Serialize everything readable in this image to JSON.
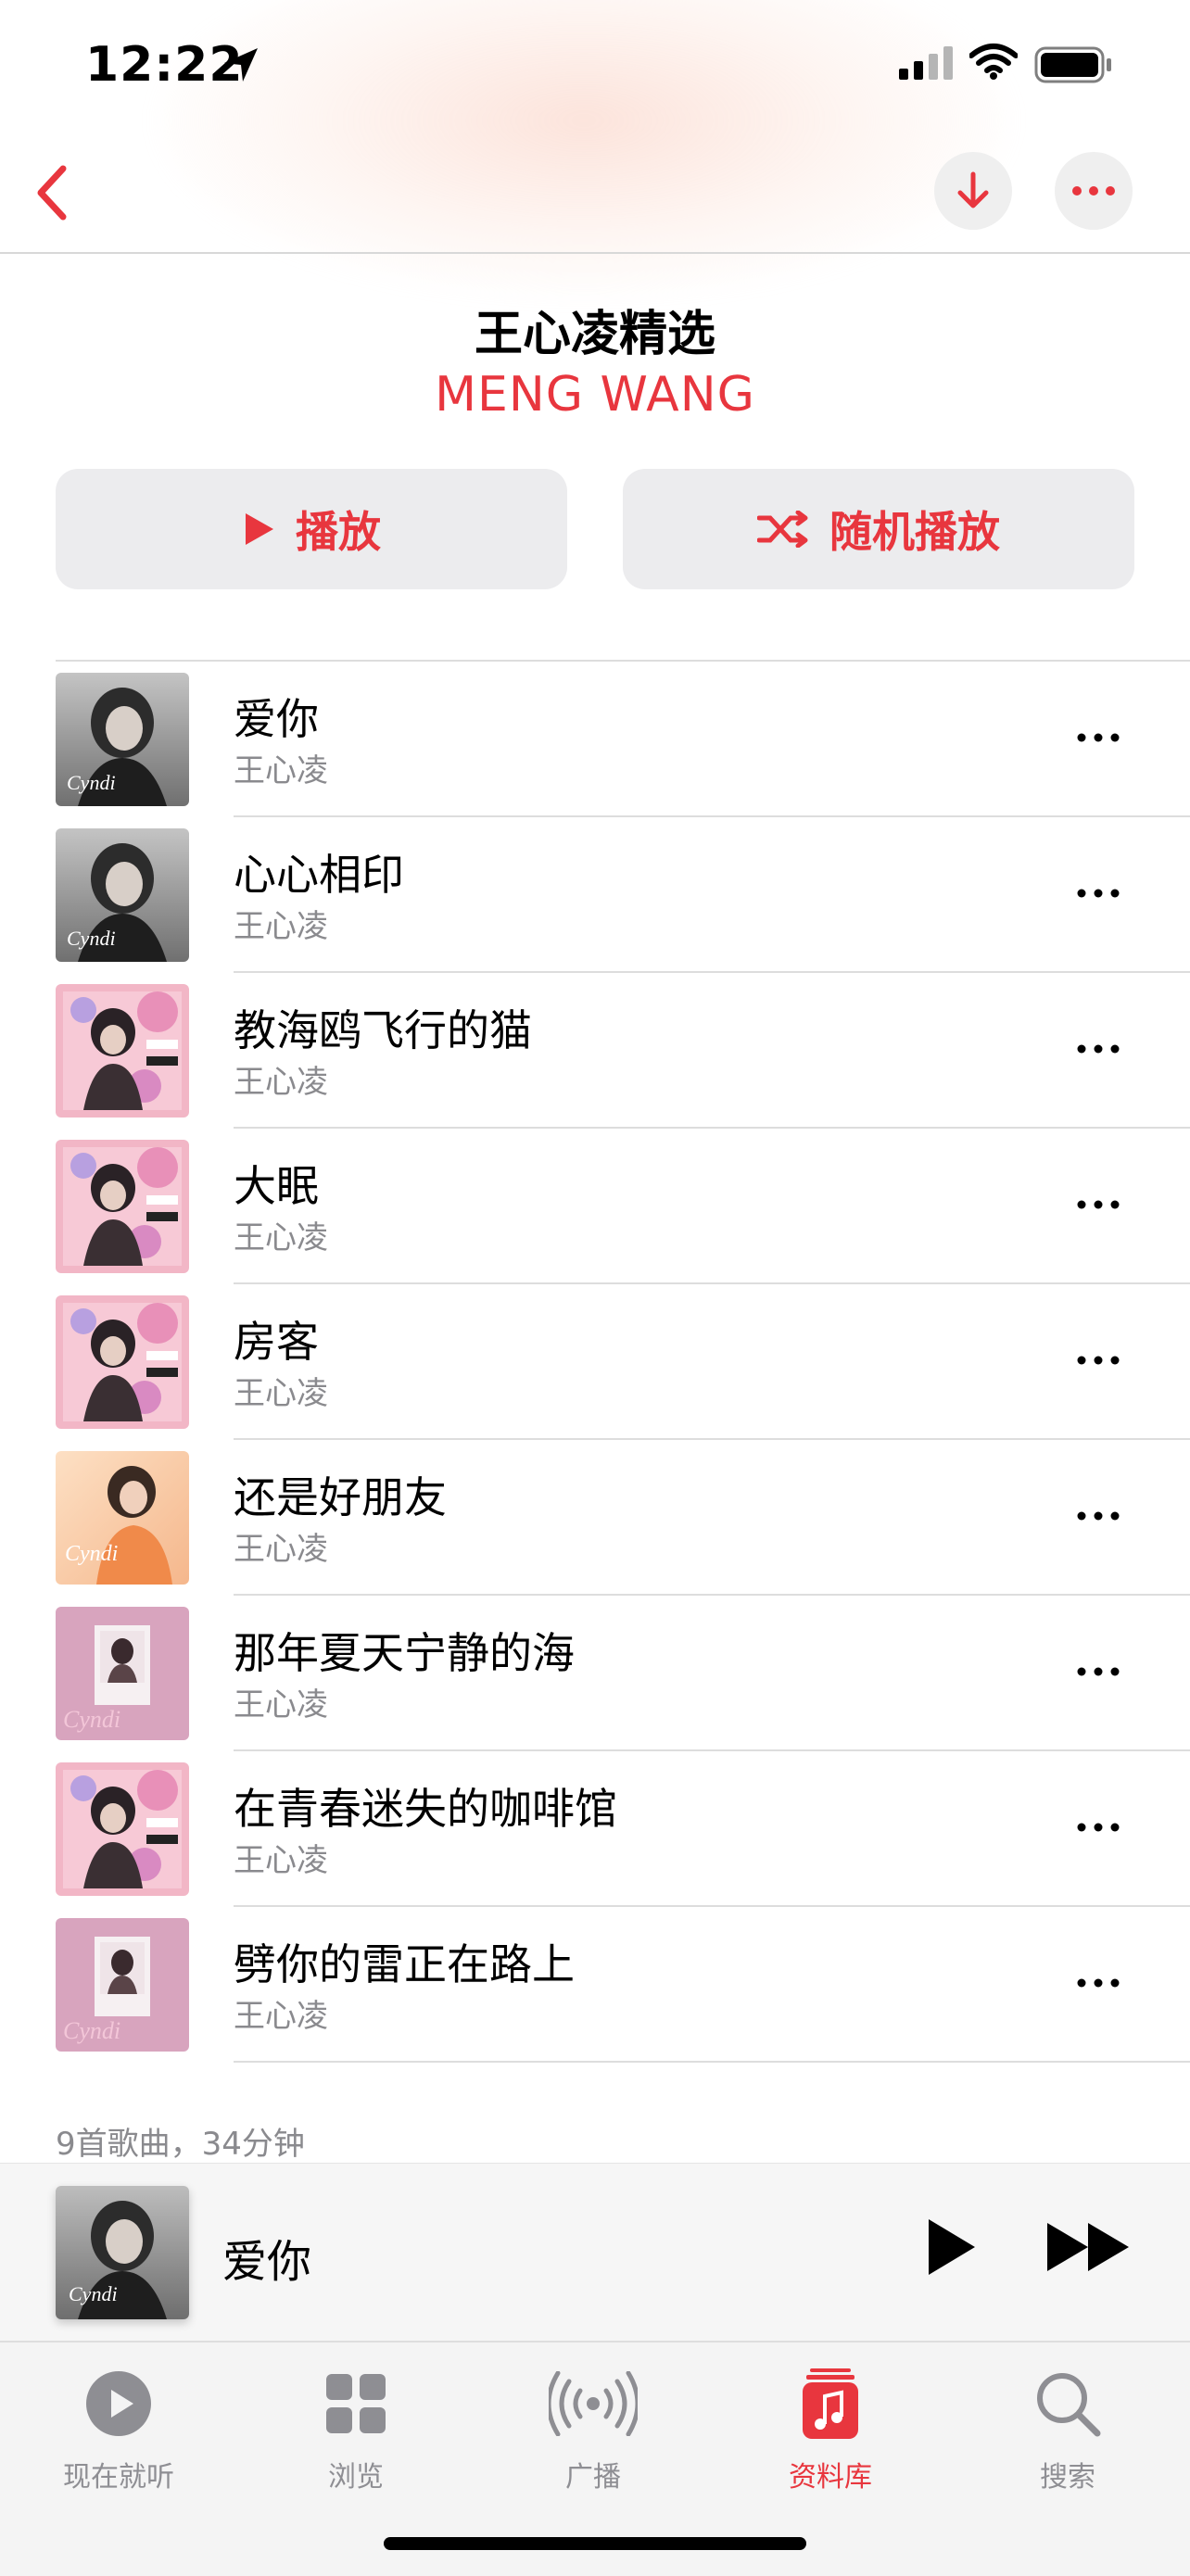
{
  "status": {
    "time": "12:22"
  },
  "header": {
    "title": "王心凌精选",
    "artist": "MENG WANG"
  },
  "actions": {
    "play": "播放",
    "shuffle": "随机播放"
  },
  "songs": [
    {
      "title": "爱你",
      "artist": "王心凌",
      "art": "bw"
    },
    {
      "title": "心心相印",
      "artist": "王心凌",
      "art": "bw"
    },
    {
      "title": "教海鸥飞行的猫",
      "artist": "王心凌",
      "art": "pink"
    },
    {
      "title": "大眠",
      "artist": "王心凌",
      "art": "pink"
    },
    {
      "title": "房客",
      "artist": "王心凌",
      "art": "pink"
    },
    {
      "title": "还是好朋友",
      "artist": "王心凌",
      "art": "peach"
    },
    {
      "title": "那年夏天宁静的海",
      "artist": "王心凌",
      "art": "mauve"
    },
    {
      "title": "在青春迷失的咖啡馆",
      "artist": "王心凌",
      "art": "pink"
    },
    {
      "title": "劈你的雷正在路上",
      "artist": "王心凌",
      "art": "mauve"
    }
  ],
  "summary": "9首歌曲，34分钟",
  "now_playing": {
    "title": "爱你"
  },
  "tabs": [
    {
      "label": "现在就听",
      "icon": "play-circle-icon",
      "active": false
    },
    {
      "label": "浏览",
      "icon": "grid-icon",
      "active": false
    },
    {
      "label": "广播",
      "icon": "broadcast-icon",
      "active": false
    },
    {
      "label": "资料库",
      "icon": "music-library-icon",
      "active": true
    },
    {
      "label": "搜索",
      "icon": "search-icon",
      "active": false
    }
  ],
  "colors": {
    "accent": "#e8363e",
    "secondary_text": "#8a8a8e"
  }
}
